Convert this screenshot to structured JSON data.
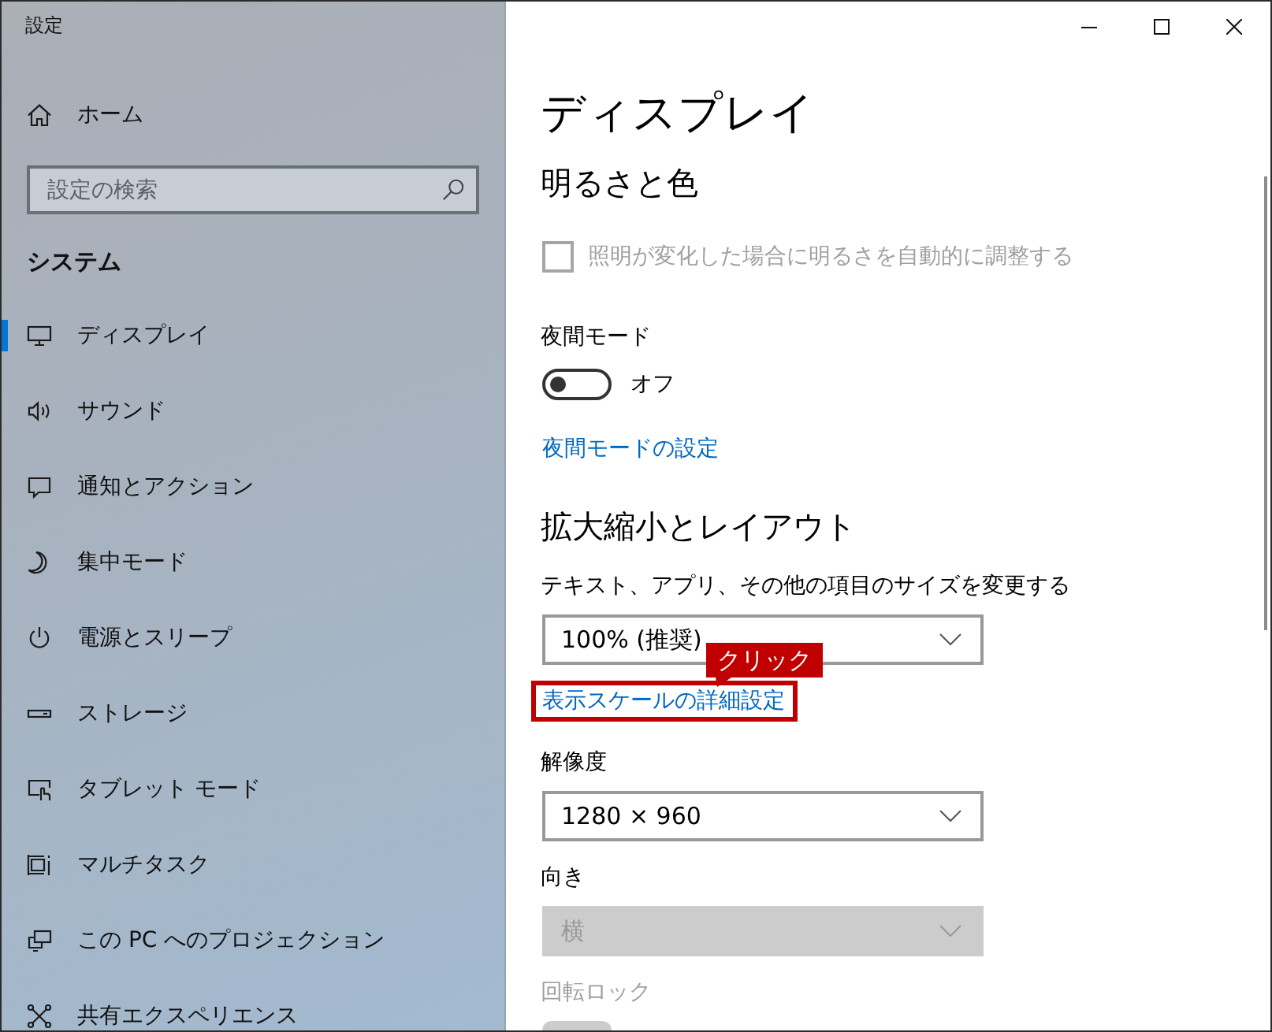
{
  "window": {
    "title": "設定"
  },
  "sidebar": {
    "home": "ホーム",
    "search": {
      "placeholder": "設定の検索"
    },
    "section": "システム",
    "items": [
      {
        "label": "ディスプレイ",
        "selected": true
      },
      {
        "label": "サウンド",
        "selected": false
      },
      {
        "label": "通知とアクション",
        "selected": false
      },
      {
        "label": "集中モード",
        "selected": false
      },
      {
        "label": "電源とスリープ",
        "selected": false
      },
      {
        "label": "ストレージ",
        "selected": false
      },
      {
        "label": "タブレット モード",
        "selected": false
      },
      {
        "label": "マルチタスク",
        "selected": false
      },
      {
        "label": "この PC へのプロジェクション",
        "selected": false
      },
      {
        "label": "共有エクスペリエンス",
        "selected": false
      }
    ]
  },
  "page": {
    "title": "ディスプレイ",
    "controls": [
      {
        "kind": "section",
        "text": "明るさと色"
      },
      {
        "kind": "checkbox",
        "label": "照明が変化した場合に明るさを自動的に調整する",
        "checked": false,
        "disabled": true
      },
      {
        "kind": "label",
        "text": "夜間モード",
        "disabled": false
      },
      {
        "kind": "toggle",
        "on": false,
        "state_text": "オフ",
        "disabled": false
      },
      {
        "kind": "link",
        "text": "夜間モードの設定",
        "highlighted": false,
        "disabled": false
      },
      {
        "kind": "section",
        "text": "拡大縮小とレイアウト"
      },
      {
        "kind": "label",
        "text": "テキスト、アプリ、その他の項目のサイズを変更する",
        "disabled": false
      },
      {
        "kind": "dropdown",
        "value": "100% (推奨)",
        "disabled": false
      },
      {
        "kind": "link",
        "text": "表示スケールの詳細設定",
        "highlighted": true,
        "callout": "クリック",
        "disabled": false
      },
      {
        "kind": "label",
        "text": "解像度",
        "disabled": false
      },
      {
        "kind": "dropdown",
        "value": "1280 × 960",
        "disabled": false
      },
      {
        "kind": "label",
        "text": "向き",
        "disabled": false
      },
      {
        "kind": "dropdown",
        "value": "横",
        "disabled": true
      },
      {
        "kind": "label",
        "text": "回転ロック",
        "disabled": true
      },
      {
        "kind": "toggle_edge",
        "disabled": true
      }
    ]
  }
}
